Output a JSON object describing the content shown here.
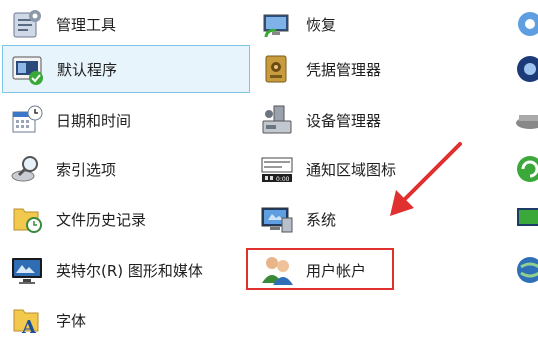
{
  "column1": [
    {
      "label": "管理工具",
      "icon": "admin-tools-icon"
    },
    {
      "label": "默认程序",
      "icon": "default-programs-icon"
    },
    {
      "label": "日期和时间",
      "icon": "date-time-icon"
    },
    {
      "label": "索引选项",
      "icon": "indexing-options-icon"
    },
    {
      "label": "文件历史记录",
      "icon": "file-history-icon"
    },
    {
      "label": "英特尔(R) 图形和媒体",
      "icon": "intel-graphics-icon"
    },
    {
      "label": "字体",
      "icon": "fonts-icon"
    }
  ],
  "column2": [
    {
      "label": "恢复",
      "icon": "recovery-icon"
    },
    {
      "label": "凭据管理器",
      "icon": "credential-manager-icon"
    },
    {
      "label": "设备管理器",
      "icon": "device-manager-icon"
    },
    {
      "label": "通知区域图标",
      "icon": "notification-area-icon"
    },
    {
      "label": "系统",
      "icon": "system-icon"
    },
    {
      "label": "用户帐户",
      "icon": "user-accounts-icon"
    }
  ],
  "column3_icons": [
    "partial-icon-1",
    "partial-icon-2",
    "partial-icon-3",
    "partial-icon-4",
    "partial-icon-5",
    "partial-icon-6"
  ],
  "colors": {
    "highlight": "#e03030",
    "selected_bg": "#e8f4fb",
    "selected_border": "#7fc4e6"
  }
}
